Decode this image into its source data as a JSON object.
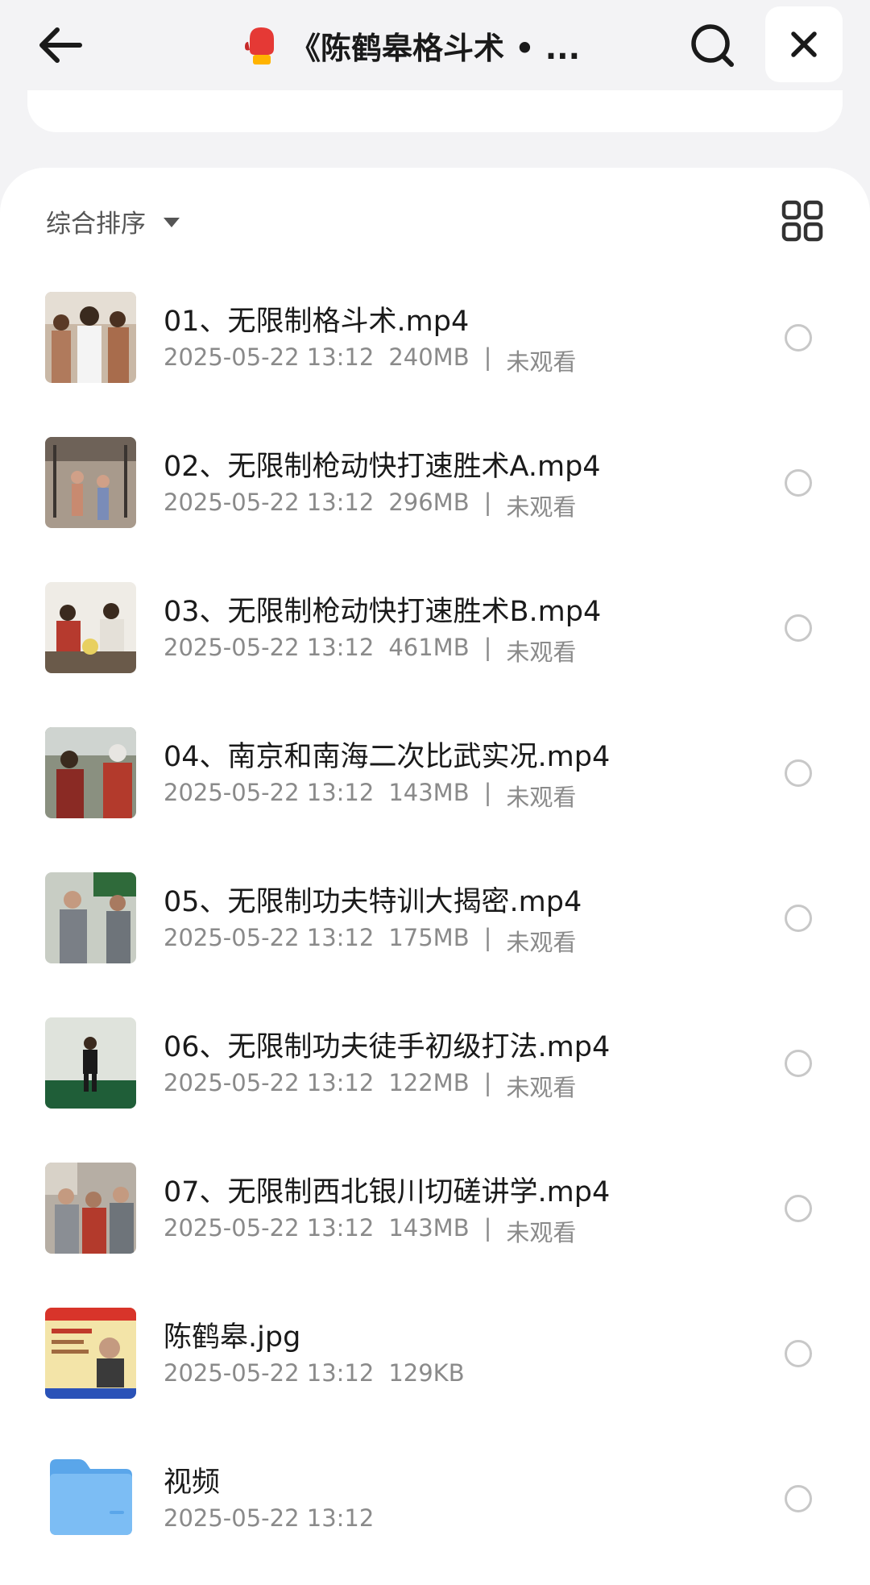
{
  "header": {
    "title": "《陈鹤皋格斗术 • ...",
    "title_icon": "boxing-glove-icon"
  },
  "toolbar": {
    "sort_label": "综合排序",
    "view_icon": "grid-view-icon"
  },
  "files": [
    {
      "name": "01、无限制格斗术.mp4",
      "date": "2025-05-22 13:12",
      "size": "240MB",
      "sep": "|",
      "status": "未观看",
      "thumb": "video"
    },
    {
      "name": "02、无限制枪动快打速胜术A.mp4",
      "date": "2025-05-22 13:12",
      "size": "296MB",
      "sep": "|",
      "status": "未观看",
      "thumb": "video"
    },
    {
      "name": "03、无限制枪动快打速胜术B.mp4",
      "date": "2025-05-22 13:12",
      "size": "461MB",
      "sep": "|",
      "status": "未观看",
      "thumb": "video"
    },
    {
      "name": "04、南京和南海二次比武实况.mp4",
      "date": "2025-05-22 13:12",
      "size": "143MB",
      "sep": "|",
      "status": "未观看",
      "thumb": "video"
    },
    {
      "name": "05、无限制功夫特训大揭密.mp4",
      "date": "2025-05-22 13:12",
      "size": "175MB",
      "sep": "|",
      "status": "未观看",
      "thumb": "video"
    },
    {
      "name": "06、无限制功夫徒手初级打法.mp4",
      "date": "2025-05-22 13:12",
      "size": "122MB",
      "sep": "|",
      "status": "未观看",
      "thumb": "video"
    },
    {
      "name": "07、无限制西北银川切磋讲学.mp4",
      "date": "2025-05-22 13:12",
      "size": "143MB",
      "sep": "|",
      "status": "未观看",
      "thumb": "video"
    },
    {
      "name": "陈鹤皋.jpg",
      "date": "2025-05-22 13:12",
      "size": "129KB",
      "thumb": "image"
    },
    {
      "name": "视频",
      "date": "2025-05-22 13:12",
      "thumb": "folder"
    }
  ],
  "colors": {
    "accent_folder": "#6fb3f0",
    "background": "#f3f3f5"
  }
}
